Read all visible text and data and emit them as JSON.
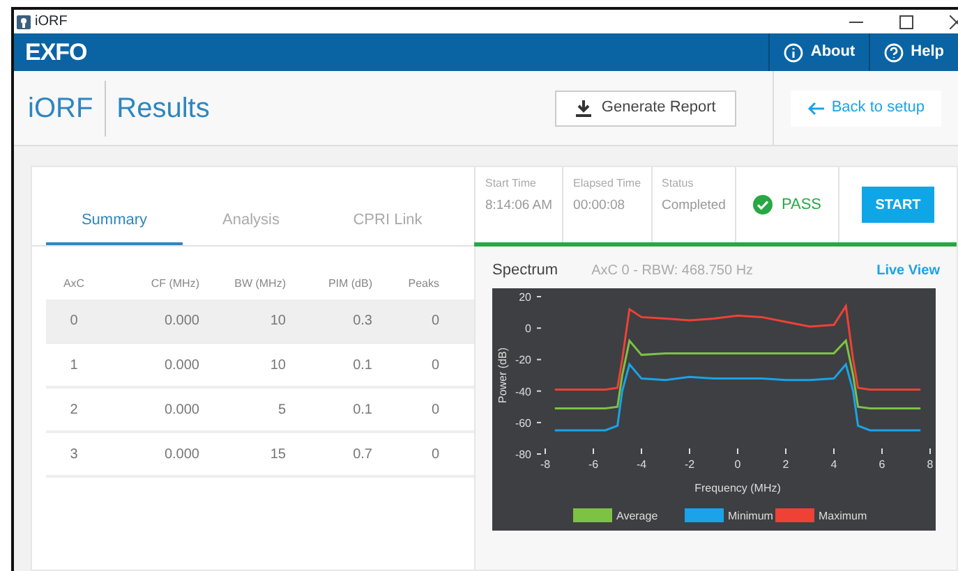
{
  "window": {
    "title": "iORF"
  },
  "app_bar": {
    "logo": "EXFO",
    "buttons": [
      {
        "label": "About",
        "kind": "about"
      },
      {
        "label": "Help",
        "kind": "help"
      }
    ]
  },
  "header": {
    "app": "iORF",
    "page": "Results",
    "generate_button": "Generate Report",
    "back_button": "Back to setup"
  },
  "tabs": [
    {
      "label": "Summary",
      "selected": true
    },
    {
      "label": "Analysis",
      "selected": false
    },
    {
      "label": "CPRI Link",
      "selected": false
    }
  ],
  "run_info": [
    {
      "label": "Start Time",
      "value": "8:14:06 AM"
    },
    {
      "label": "Elapsed Time",
      "value": "00:00:08"
    },
    {
      "label": "Status",
      "value": "Completed"
    }
  ],
  "verdict": {
    "text": "PASS",
    "passed": true
  },
  "start_button": "START",
  "table": {
    "columns": [
      "AxC",
      "CF (MHz)",
      "BW (MHz)",
      "PIM (dB)",
      "Peaks"
    ],
    "rows": [
      {
        "cells": [
          "0",
          "0.000",
          "10",
          "0.3",
          "0"
        ],
        "selected": true
      },
      {
        "cells": [
          "1",
          "0.000",
          "10",
          "0.1",
          "0"
        ],
        "selected": false
      },
      {
        "cells": [
          "2",
          "0.000",
          "5",
          "0.1",
          "0"
        ],
        "selected": false
      },
      {
        "cells": [
          "3",
          "0.000",
          "15",
          "0.7",
          "0"
        ],
        "selected": false
      }
    ]
  },
  "spectrum": {
    "title": "Spectrum",
    "subtitle": "AxC 0 - RBW: 468.750 Hz",
    "link": "Live View",
    "chart_data": {
      "type": "line",
      "legend": true,
      "xlabel": "Frequency (MHz)",
      "ylabel": "Power (dB)",
      "xlim": [
        -8,
        8
      ],
      "ylim": [
        -80,
        20
      ],
      "xticks": [
        {
          "value": -8,
          "label": "-8"
        },
        {
          "value": -6,
          "label": "-6"
        },
        {
          "value": -4,
          "label": "-4"
        },
        {
          "value": -2,
          "label": "-2"
        },
        {
          "value": 0,
          "label": "0"
        },
        {
          "value": 2,
          "label": "2"
        },
        {
          "value": 4,
          "label": "4"
        },
        {
          "value": 6,
          "label": "6"
        },
        {
          "value": 8,
          "label": "8"
        }
      ],
      "yticks": [
        {
          "value": -80,
          "label": "-80"
        },
        {
          "value": -60,
          "label": "-60"
        },
        {
          "value": -40,
          "label": "-40"
        },
        {
          "value": -20,
          "label": "-20"
        },
        {
          "value": 0,
          "label": "0"
        },
        {
          "value": 20,
          "label": "20"
        }
      ],
      "x": [
        -7.6,
        -6.5,
        -5.5,
        -5,
        -4.8,
        -4.5,
        -4,
        -3,
        -2,
        -1,
        0,
        1,
        2,
        3,
        4,
        4.5,
        4.8,
        5,
        5.5,
        6.5,
        7.6
      ],
      "series": [
        {
          "name": "Average",
          "color": "#7dc242",
          "values": [
            -51,
            -51,
            -51,
            -50,
            -30,
            -8,
            -17,
            -16,
            -16,
            -16,
            -16,
            -16,
            -16,
            -16,
            -16,
            -8,
            -30,
            -50,
            -51,
            -51,
            -51
          ]
        },
        {
          "name": "Minimum",
          "color": "#1aa3e8",
          "values": [
            -65,
            -65,
            -65,
            -62,
            -40,
            -23,
            -32,
            -33,
            -31,
            -32,
            -32,
            -32,
            -33,
            -33,
            -32,
            -23,
            -40,
            -62,
            -65,
            -65,
            -65
          ]
        },
        {
          "name": "Maximum",
          "color": "#ef4136",
          "values": [
            -39,
            -39,
            -39,
            -38,
            -20,
            12,
            7,
            6,
            5,
            6,
            8,
            7,
            4,
            1,
            2,
            14,
            -20,
            -38,
            -39,
            -39,
            -39
          ]
        }
      ]
    }
  }
}
